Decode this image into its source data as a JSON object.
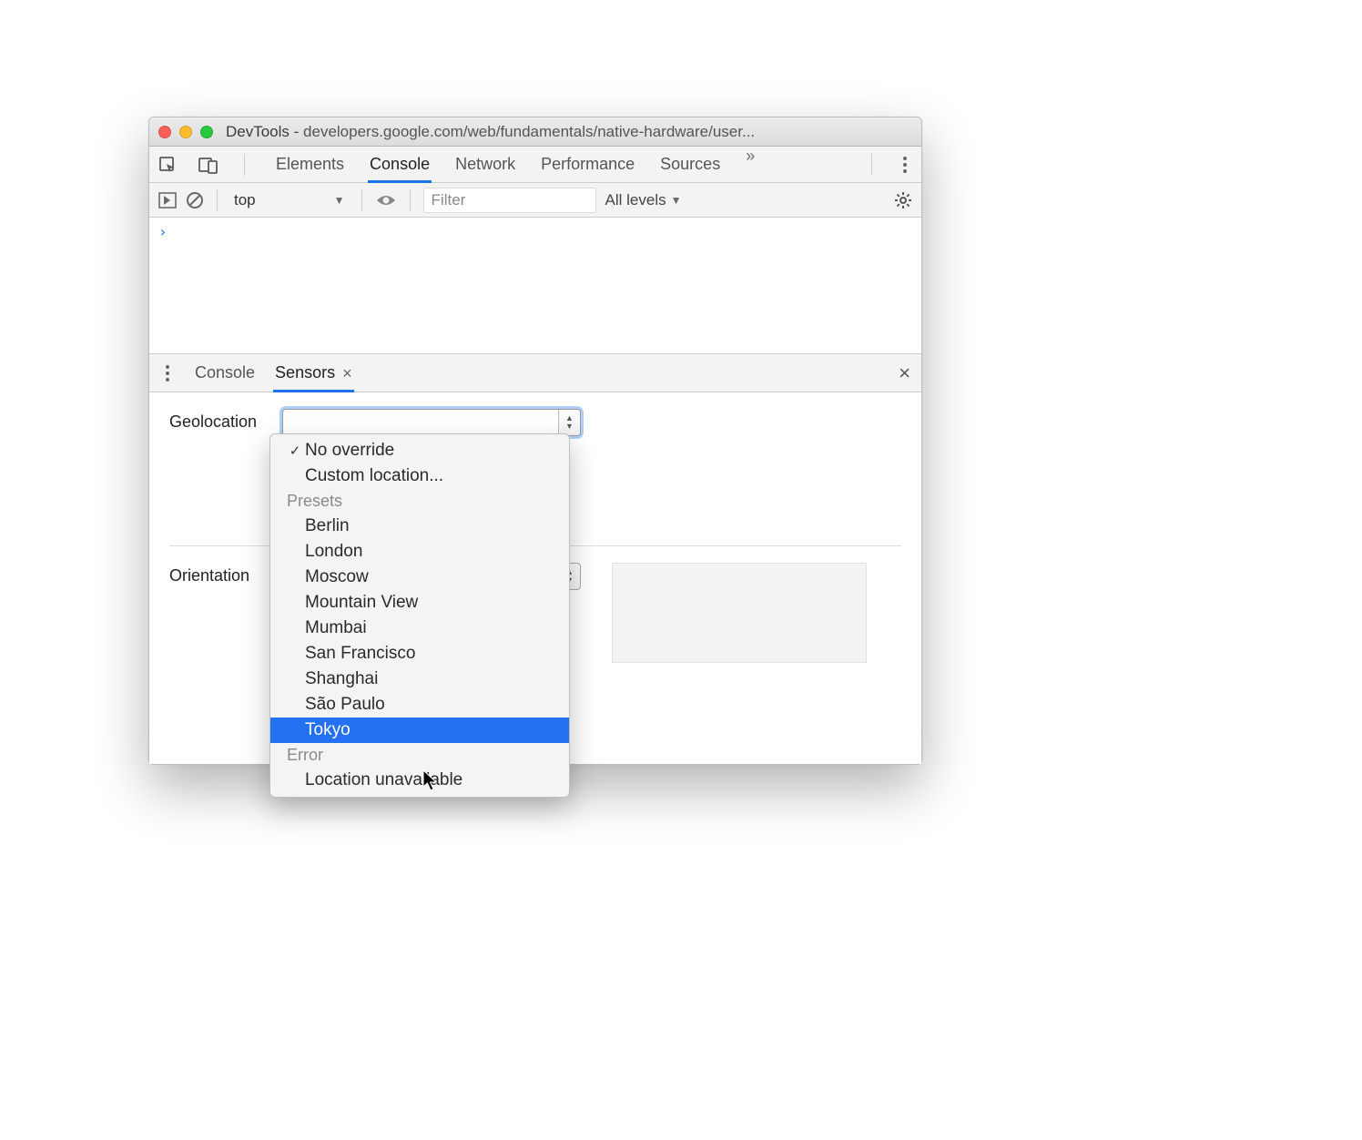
{
  "window": {
    "app": "DevTools",
    "separator": " - ",
    "url": "developers.google.com/web/fundamentals/native-hardware/user..."
  },
  "mainTabs": {
    "t0": "Elements",
    "t1": "Console",
    "t2": "Network",
    "t3": "Performance",
    "t4": "Sources"
  },
  "consoleToolbar": {
    "context": "top",
    "filterPlaceholder": "Filter",
    "levels": "All levels"
  },
  "console": {
    "prompt": "›"
  },
  "drawerTabs": {
    "t0": "Console",
    "t1": "Sensors"
  },
  "sensors": {
    "geolocationLabel": "Geolocation",
    "orientationLabel": "Orientation"
  },
  "geoDropdown": {
    "noOverride": "No override",
    "custom": "Custom location...",
    "presetsHeader": "Presets",
    "presets": {
      "p0": "Berlin",
      "p1": "London",
      "p2": "Moscow",
      "p3": "Mountain View",
      "p4": "Mumbai",
      "p5": "San Francisco",
      "p6": "Shanghai",
      "p7": "São Paulo",
      "p8": "Tokyo"
    },
    "errorHeader": "Error",
    "errorItems": {
      "e0": "Location unavailable"
    }
  }
}
